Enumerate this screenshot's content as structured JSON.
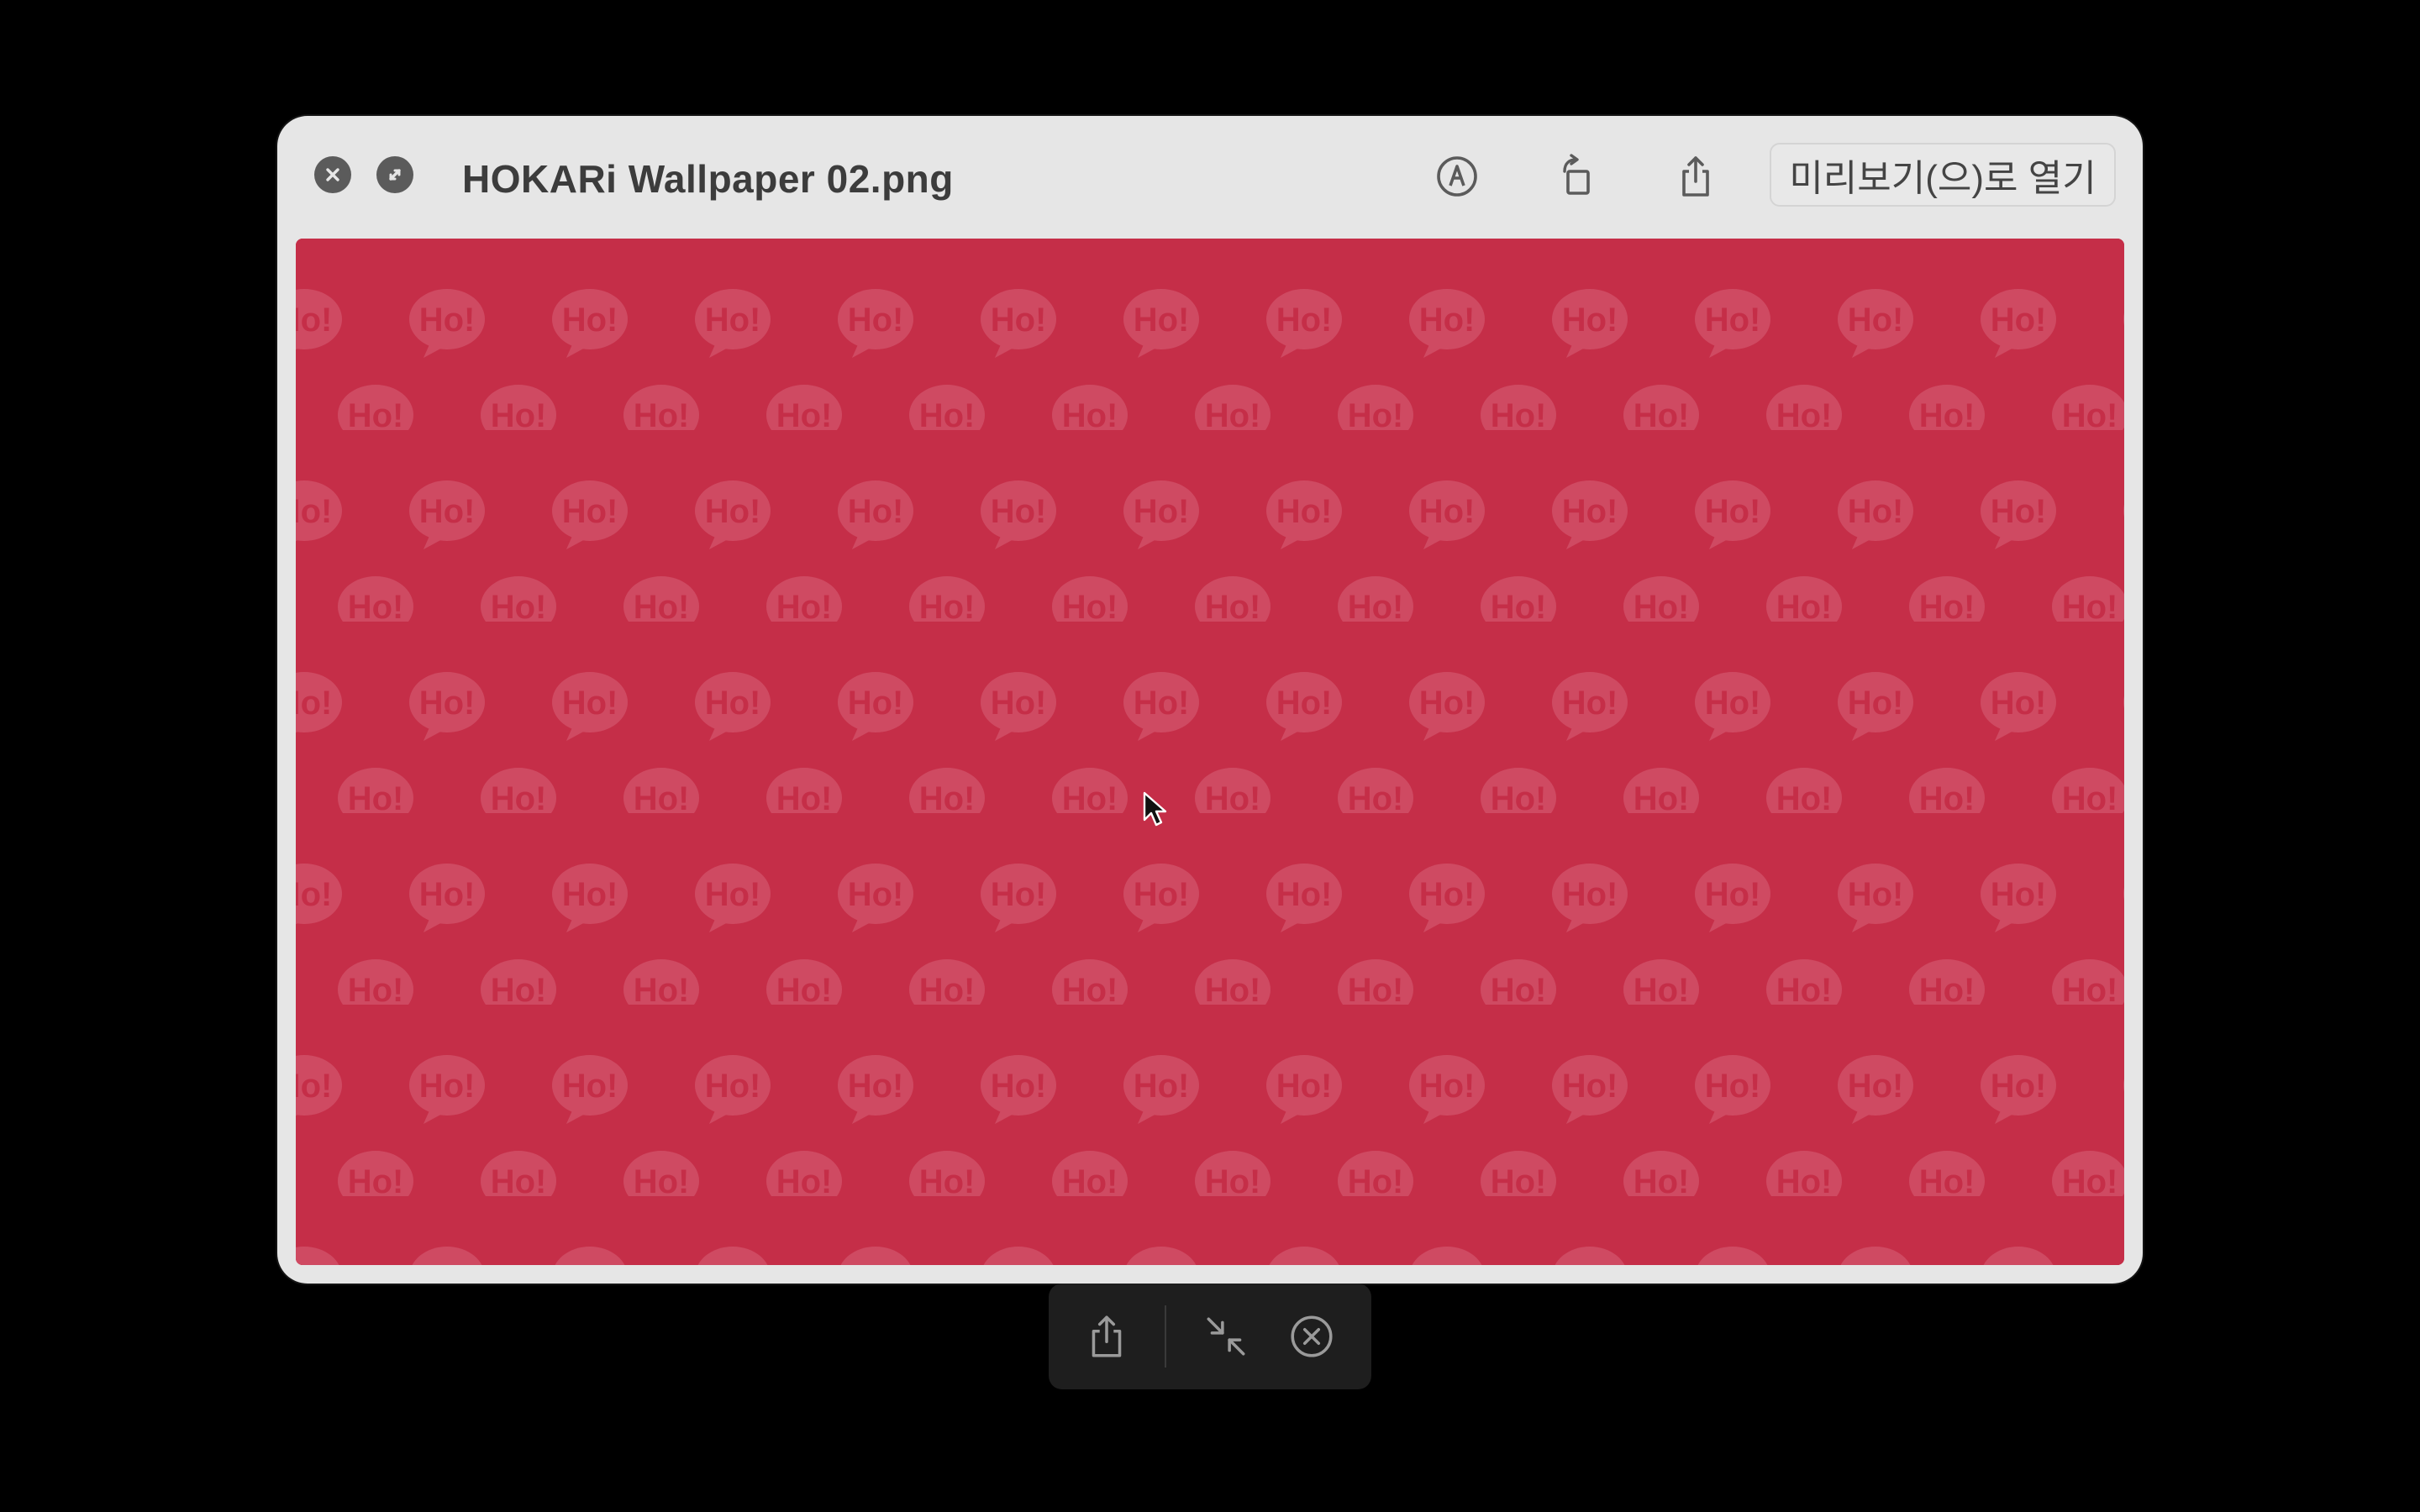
{
  "window": {
    "title": "HOKARi Wallpaper 02.png",
    "open_with_label": "미리보기(으)로 열기"
  },
  "titlebar_icons": {
    "close": "close-icon",
    "fullscreen": "fullscreen-icon",
    "markup": "markup-icon",
    "rotate": "rotate-left-icon",
    "share": "share-icon"
  },
  "image": {
    "pattern_text": "Ho!",
    "background_color": "#c52e48",
    "bubble_color": "#cf4a62"
  },
  "bottom_bar": {
    "icons": [
      "share-icon",
      "exit-fullscreen-icon",
      "close-icon"
    ]
  },
  "colors": {
    "desktop": "#000000",
    "window_chrome": "#e6e6e6",
    "icon": "#5b5b5b",
    "bottom_bar": "#1e1e1e"
  }
}
